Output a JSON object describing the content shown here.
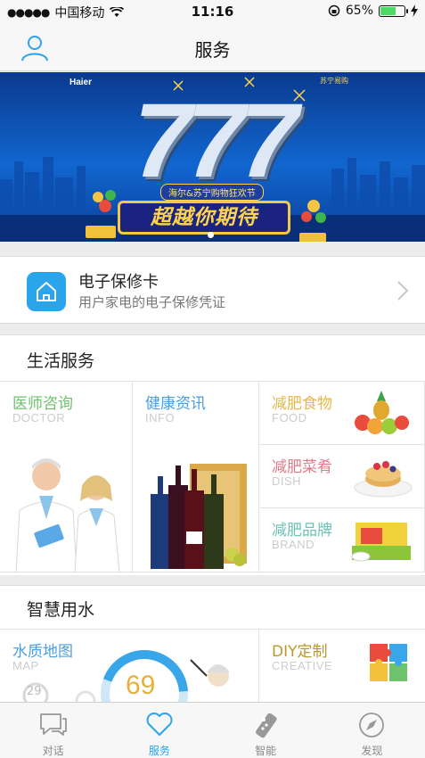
{
  "status_bar": {
    "carrier": "中国移动",
    "time": "11:16",
    "battery": "65%",
    "battery_level": 0.65
  },
  "nav": {
    "title": "服务",
    "icon": "user-icon"
  },
  "banner": {
    "brand_left": "Haier",
    "brand_right": "苏宁易购",
    "headline": "777",
    "subtitle": "海尔&苏宁购物狂欢节",
    "slogan": "超越你期待"
  },
  "warranty": {
    "title": "电子保修卡",
    "desc": "用户家电的电子保修凭证",
    "icon": "home-icon",
    "color": "#2aa4ea"
  },
  "life_service": {
    "title": "生活服务",
    "tiles": [
      {
        "title": "医师咨询",
        "sub": "DOCTOR",
        "color": "#6cc36c"
      },
      {
        "title": "健康资讯",
        "sub": "INFO",
        "color": "#4a9ee0"
      },
      {
        "title": "减肥食物",
        "sub": "FOOD",
        "color": "#e6b84a"
      },
      {
        "title": "减肥菜肴",
        "sub": "DISH",
        "color": "#e07b8a"
      },
      {
        "title": "减肥品牌",
        "sub": "BRAND",
        "color": "#6cc3b6"
      }
    ]
  },
  "water": {
    "title": "智慧用水",
    "tiles": [
      {
        "title": "水质地图",
        "sub": "MAP",
        "color": "#4a9ee0",
        "value": "69",
        "badge": "29"
      },
      {
        "title": "DIY定制",
        "sub": "CREATIVE",
        "color": "#b99a2a"
      }
    ]
  },
  "tabs": [
    {
      "label": "对话",
      "icon": "chat-icon"
    },
    {
      "label": "服务",
      "icon": "heart-icon",
      "active": true
    },
    {
      "label": "智能",
      "icon": "remote-icon"
    },
    {
      "label": "发现",
      "icon": "compass-icon"
    }
  ]
}
